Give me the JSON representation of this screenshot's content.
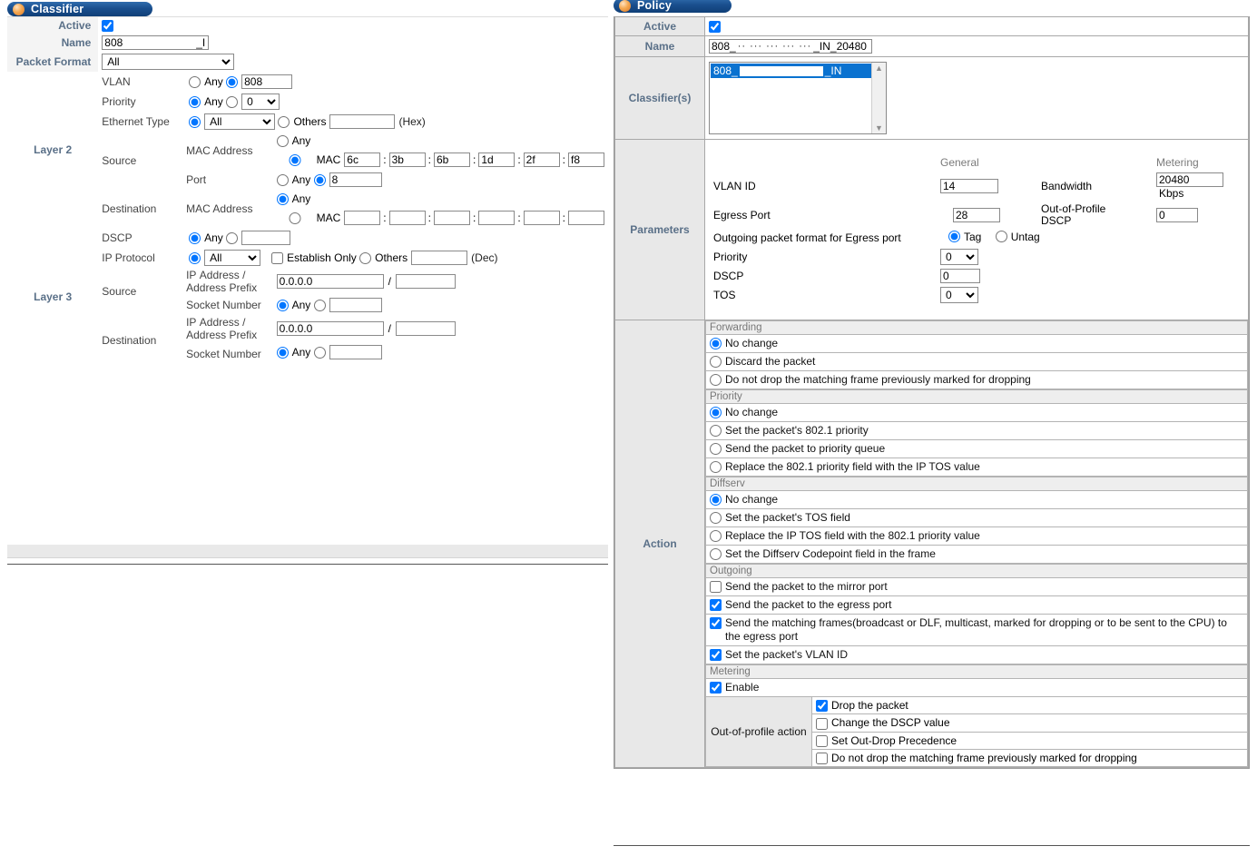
{
  "classifier": {
    "panel_title": "Classifier",
    "labels": {
      "active": "Active",
      "name": "Name",
      "packet_format": "Packet Format",
      "layer2": "Layer 2",
      "layer3": "Layer 3",
      "vlan": "VLAN",
      "priority": "Priority",
      "ethernet_type": "Ethernet Type",
      "source": "Source",
      "destination": "Destination",
      "mac_address": "MAC Address",
      "port": "Port",
      "dscp": "DSCP",
      "ip_protocol": "IP Protocol",
      "ip_address_prefix": "IP Address / Address Prefix",
      "socket_number": "Socket Number",
      "any": "Any",
      "mac": "MAC",
      "others": "Others",
      "hex_note": "(Hex)",
      "dec_note": "(Dec)",
      "establish_only": "Establish Only",
      "slash": "/"
    },
    "values": {
      "active_checked": true,
      "name": "808",
      "name_suffix": "_I",
      "packet_format": "All",
      "vlan_any_selected": false,
      "vlan_value": "808",
      "priority_any_selected": true,
      "priority_value": "0",
      "ethernet_type_list_selected": true,
      "ethernet_type": "All",
      "ethernet_type_others": "",
      "src_mac_any_selected": false,
      "src_mac": [
        "6c",
        "3b",
        "6b",
        "1d",
        "2f",
        "f8"
      ],
      "src_port_any_selected": false,
      "src_port": "8",
      "dst_mac_any_selected": true,
      "dst_mac": [
        "",
        "",
        "",
        "",
        "",
        ""
      ],
      "dscp_any_selected": true,
      "dscp_value": "",
      "ip_protocol_list_selected": true,
      "ip_protocol": "All",
      "ip_protocol_others": "",
      "establish_only_checked": false,
      "src_ip": "0.0.0.0",
      "src_prefix": "",
      "src_socket_any_selected": true,
      "src_socket": "",
      "dst_ip": "0.0.0.0",
      "dst_prefix": "",
      "dst_socket_any_selected": true,
      "dst_socket": ""
    }
  },
  "policy": {
    "panel_title": "Policy",
    "labels": {
      "active": "Active",
      "name": "Name",
      "classifiers": "Classifier(s)",
      "parameters": "Parameters",
      "action": "Action"
    },
    "values": {
      "active_checked": true,
      "name_prefix": "808_",
      "name_redacted": "·· ··· ··· ··· ···",
      "name_suffix": "_IN_20480"
    },
    "classifier_list": {
      "items": [
        {
          "prefix": "808_",
          "redacted": true,
          "suffix": "_IN",
          "selected": true
        }
      ]
    },
    "parameters": {
      "general_header": "General",
      "metering_header": "Metering",
      "rows": {
        "vlan_id_label": "VLAN ID",
        "vlan_id": "14",
        "egress_port_label": "Egress Port",
        "egress_port": "28",
        "outgoing_format_label": "Outgoing packet format for Egress port",
        "outgoing_format_tag": "Tag",
        "outgoing_format_untag": "Untag",
        "outgoing_format_selected": "Tag",
        "priority_label": "Priority",
        "priority": "0",
        "dscp_label": "DSCP",
        "dscp": "0",
        "tos_label": "TOS",
        "tos": "0",
        "bandwidth_label": "Bandwidth",
        "bandwidth": "20480",
        "bandwidth_unit": "Kbps",
        "oop_dscp_label": "Out-of-Profile DSCP",
        "oop_dscp": "0"
      }
    },
    "action": {
      "sections": [
        {
          "title": "Forwarding",
          "type": "radio",
          "items": [
            {
              "label": "No change",
              "checked": true
            },
            {
              "label": "Discard the packet",
              "checked": false
            },
            {
              "label": "Do not drop the matching frame previously marked for dropping",
              "checked": false
            }
          ]
        },
        {
          "title": "Priority",
          "type": "radio",
          "items": [
            {
              "label": "No change",
              "checked": true
            },
            {
              "label": "Set the packet's 802.1 priority",
              "checked": false
            },
            {
              "label": "Send the packet to priority queue",
              "checked": false
            },
            {
              "label": "Replace the 802.1 priority field with the IP TOS value",
              "checked": false
            }
          ]
        },
        {
          "title": "Diffserv",
          "type": "radio",
          "items": [
            {
              "label": "No change",
              "checked": true
            },
            {
              "label": "Set the packet's TOS field",
              "checked": false
            },
            {
              "label": "Replace the IP TOS field with the 802.1 priority value",
              "checked": false
            },
            {
              "label": "Set the Diffserv Codepoint field in the frame",
              "checked": false
            }
          ]
        },
        {
          "title": "Outgoing",
          "type": "checkbox",
          "items": [
            {
              "label": "Send the packet to the mirror port",
              "checked": false
            },
            {
              "label": "Send the packet to the egress port",
              "checked": true
            },
            {
              "label": "Send the matching frames(broadcast or DLF, multicast, marked for dropping or to be sent to the CPU) to the egress port",
              "checked": true
            },
            {
              "label": "Set the packet's VLAN ID",
              "checked": true
            }
          ]
        },
        {
          "title": "Metering",
          "type": "checkbox",
          "items": [
            {
              "label": "Enable",
              "checked": true
            }
          ]
        }
      ],
      "out_of_profile": {
        "label": "Out-of-profile action",
        "items": [
          {
            "label": "Drop the packet",
            "checked": true
          },
          {
            "label": "Change the DSCP value",
            "checked": false
          },
          {
            "label": "Set Out-Drop Precedence",
            "checked": false
          },
          {
            "label": "Do not drop the matching frame previously marked for dropping",
            "checked": false
          }
        ]
      }
    }
  },
  "colors": {
    "title_bar": "#1a4f8e",
    "selection": "#0a72d0",
    "label_text": "#5a7088",
    "panel_bg": "#f4f4f4"
  }
}
